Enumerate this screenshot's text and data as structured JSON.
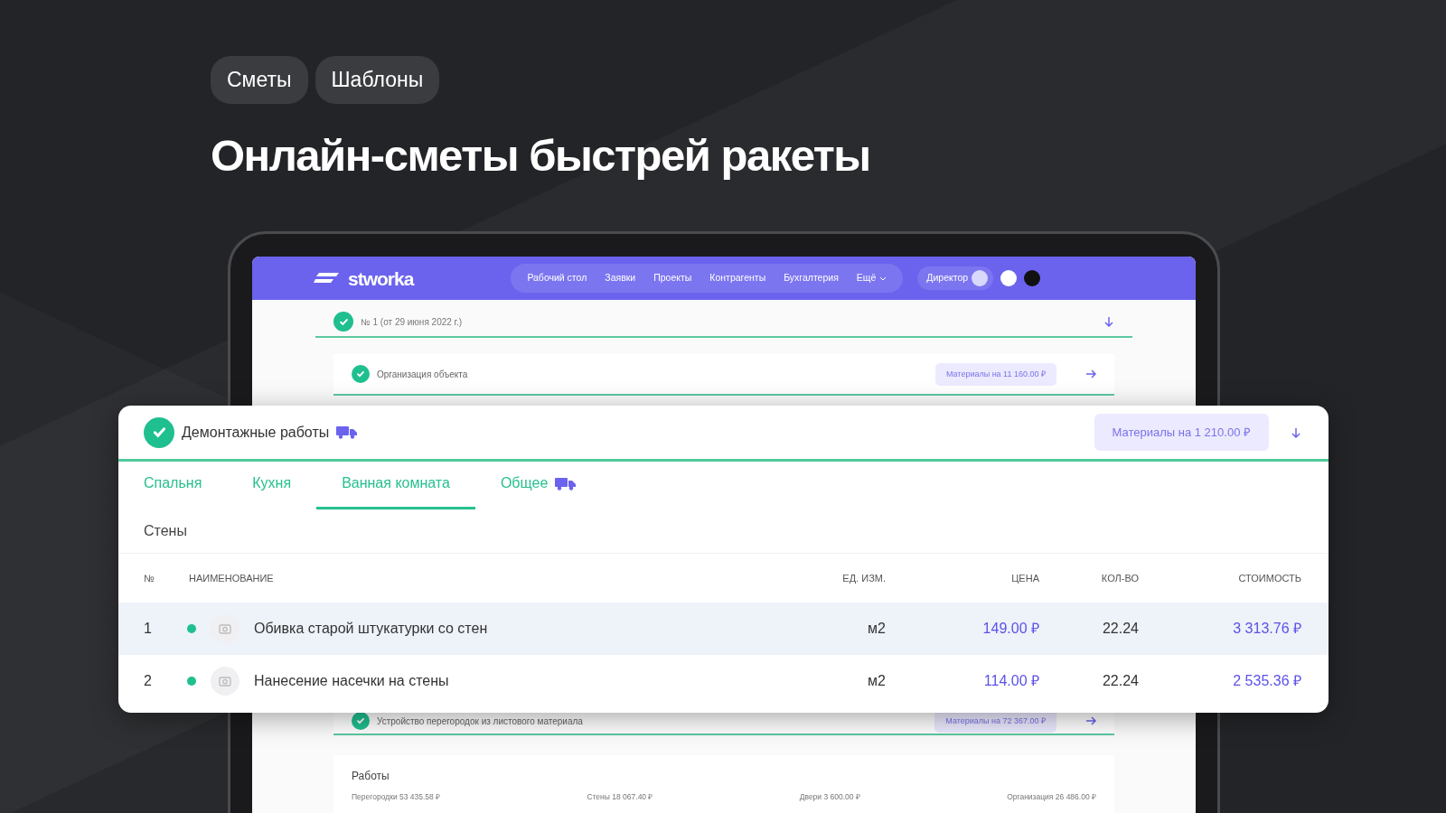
{
  "tags": [
    {
      "label": "Сметы"
    },
    {
      "label": "Шаблоны"
    }
  ],
  "headline": "Онлайн-сметы быстрей ракеты",
  "app": {
    "logo": "stworka",
    "nav": [
      {
        "label": "Рабочий стол"
      },
      {
        "label": "Заявки"
      },
      {
        "label": "Проекты"
      },
      {
        "label": "Контрагенты"
      },
      {
        "label": "Бухгалтерия"
      },
      {
        "label": "Ещё",
        "dropdown": true
      }
    ],
    "user": "Директор",
    "estimate": {
      "title": "№ 1 (от 29 июня 2022 г.)",
      "done": true
    },
    "sections_above": [
      {
        "title": "Организация объекта",
        "materials": "Материалы на 11 160.00 ₽",
        "done": true
      }
    ],
    "section": {
      "title": "Демонтажные работы",
      "done": true,
      "delivery": true,
      "materials": "Материалы на 1 210.00 ₽",
      "tabs": [
        {
          "label": "Спальня",
          "selected": false,
          "delivery": false
        },
        {
          "label": "Кухня",
          "selected": false,
          "delivery": false
        },
        {
          "label": "Ванная комната",
          "selected": true,
          "delivery": false
        },
        {
          "label": "Общее",
          "selected": false,
          "delivery": true
        }
      ],
      "group": "Стены",
      "columns": [
        "№",
        "НАИМЕНОВАНИЕ",
        "ЕД. ИЗМ.",
        "ЦЕНА",
        "КОЛ-ВО",
        "СТОИМОСТЬ"
      ],
      "rows": [
        {
          "number": "1",
          "name": "Обивка старой штукатурки со стен",
          "unit": "м2",
          "price": "149.00 ₽",
          "qty": "22.24",
          "cost": "3 313.76 ₽",
          "highlighted": true
        },
        {
          "number": "2",
          "name": "Нанесение насечки на стены",
          "unit": "м2",
          "price": "114.00 ₽",
          "qty": "22.24",
          "cost": "2 535.36 ₽",
          "highlighted": false
        }
      ]
    },
    "sections_below": [
      {
        "title": "Устройство перегородок из листового материала",
        "materials": "Материалы на 72 367.00 ₽",
        "done": true
      }
    ],
    "works": {
      "title": "Работы",
      "items": [
        "Перегородки 53 435.58 ₽",
        "Стены 18 067.40 ₽",
        "Двери 3 600.00 ₽",
        "Организация 26 486.00 ₽"
      ]
    }
  }
}
